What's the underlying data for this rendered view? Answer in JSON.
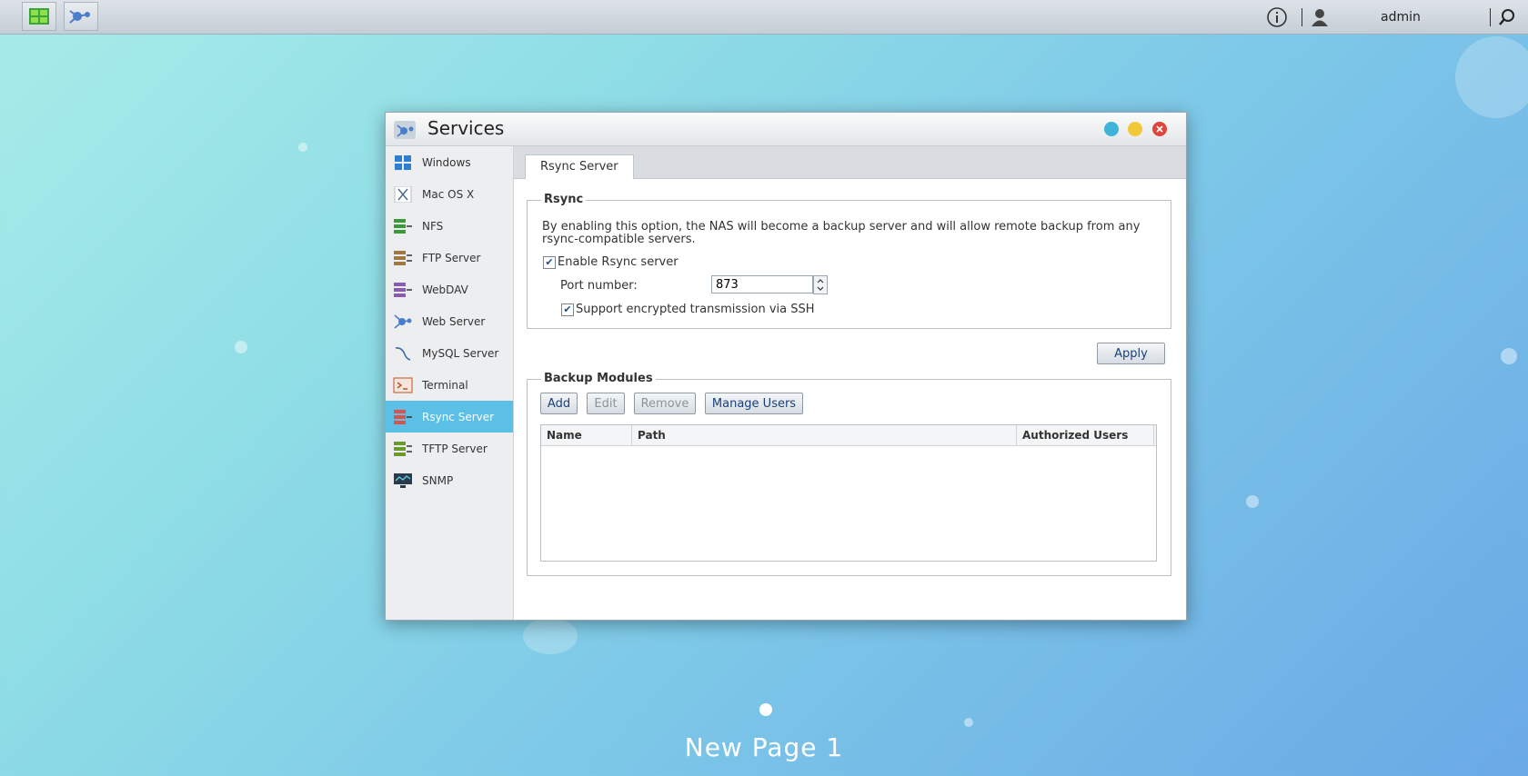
{
  "taskbar": {
    "username": "admin"
  },
  "window": {
    "title": "Services",
    "sidebar": [
      {
        "label": "Windows",
        "icon": "windows-icon"
      },
      {
        "label": "Mac OS X",
        "icon": "mac-icon"
      },
      {
        "label": "NFS",
        "icon": "nfs-icon"
      },
      {
        "label": "FTP Server",
        "icon": "ftp-icon"
      },
      {
        "label": "WebDAV",
        "icon": "webdav-icon"
      },
      {
        "label": "Web Server",
        "icon": "web-server-icon"
      },
      {
        "label": "MySQL Server",
        "icon": "mysql-icon"
      },
      {
        "label": "Terminal",
        "icon": "terminal-icon"
      },
      {
        "label": "Rsync Server",
        "icon": "rsync-icon",
        "active": true
      },
      {
        "label": "TFTP Server",
        "icon": "tftp-icon"
      },
      {
        "label": "SNMP",
        "icon": "snmp-icon"
      }
    ],
    "tab": "Rsync Server",
    "rsync": {
      "legend": "Rsync",
      "description": "By enabling this option, the NAS will become a backup server and will allow remote backup from any rsync-compatible servers.",
      "enable_label": "Enable Rsync server",
      "enable_checked": true,
      "port_label": "Port number:",
      "port_value": "873",
      "ssh_label": "Support encrypted transmission via SSH",
      "ssh_checked": true
    },
    "apply_label": "Apply",
    "backup": {
      "legend": "Backup Modules",
      "buttons": {
        "add": "Add",
        "edit": "Edit",
        "remove": "Remove",
        "manage": "Manage Users"
      },
      "columns": [
        "Name",
        "Path",
        "Authorized Users"
      ],
      "rows": []
    }
  },
  "desktop": {
    "page_label": "New Page 1"
  }
}
